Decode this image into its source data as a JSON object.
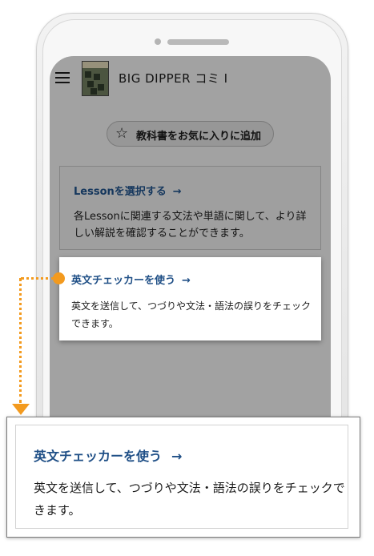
{
  "app": {
    "title": "BIG DIPPER コミ I",
    "thumbnail_text": "BIG DIPPER"
  },
  "favorite_button": {
    "icon": "star-outline-icon",
    "label": "教科書をお気に入りに追加"
  },
  "lesson_card": {
    "heading": "Lessonを選択する",
    "arrow": "→",
    "description": "各Lessonに関連する文法や単語に関して、より詳しい解説を確認することができます。"
  },
  "checker_card": {
    "heading": "英文チェッカーを使う",
    "arrow": "→",
    "description": "英文を送信して、つづりや文法・語法の誤りをチェックできます。"
  },
  "zoom_card": {
    "heading": "英文チェッカーを使う",
    "arrow": "→",
    "description": "英文を送信して、つづりや文法・語法の誤りをチェックできます。"
  },
  "colors": {
    "accent_orange": "#f39a1e",
    "link_blue": "#1f4f86"
  }
}
